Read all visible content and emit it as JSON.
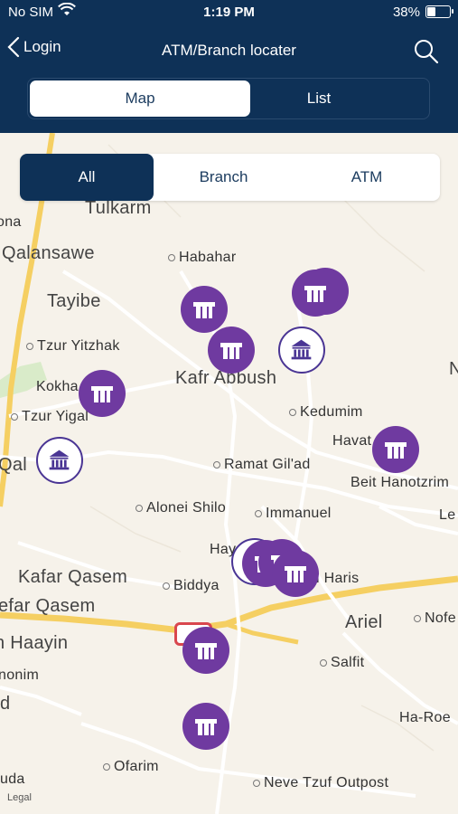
{
  "status": {
    "carrier": "No SIM",
    "time": "1:19 PM",
    "battery": "38%"
  },
  "nav": {
    "back_label": "Login",
    "title": "ATM/Branch locater"
  },
  "view_tabs": {
    "map": "Map",
    "list": "List"
  },
  "filters": {
    "all": "All",
    "branch": "Branch",
    "atm": "ATM"
  },
  "places": {
    "tulkarm": "Tulkarm",
    "qalansawe": "Qalansawe",
    "habahar": "Habahar",
    "tayibe": "Tayibe",
    "tzur_yitzhak": "Tzur Yitzhak",
    "kokhav_yair_partial": "Kokha",
    "kafr_abbush": "Kafr Abbush",
    "tzur_yigal": "Tzur Yigal",
    "kedumim": "Kedumim",
    "havat_partial": "Havat",
    "qalqilya_partial": "Qal",
    "ramat_gilad": "Ramat Gil'ad",
    "beit_hanotzrim_partial": "Beit Hanotzrim",
    "alonei_shilo": "Alonei Shilo",
    "immanuel": "Immanuel",
    "le_partial": "Le",
    "hay_partial": "Hay",
    "haris_partial": "l Haris",
    "kafar_qasem": "Kafar Qasem",
    "biddya": "Biddya",
    "kfar_qasem_partial": "efar Qasem",
    "ariel": "Ariel",
    "nofe_partial": "Nofe",
    "rosh_haayin_partial": "n Haayin",
    "salfit": "Salfit",
    "nonim_partial": "nonim",
    "d_partial": "d",
    "ha_roe_partial": "Ha-Roe",
    "uda_partial": "uda",
    "ofarim": "Ofarim",
    "neve_tzuf": "Neve Tzuf Outpost",
    "n_partial": "N",
    "ona_partial": "ona"
  },
  "legal": "Legal",
  "colors": {
    "header": "#0e3157",
    "atm_marker": "#6f3aa0",
    "branch_ring": "#4a3594"
  },
  "markers": {
    "atm_types": "atm-icon",
    "branch_types": "bank-icon"
  }
}
